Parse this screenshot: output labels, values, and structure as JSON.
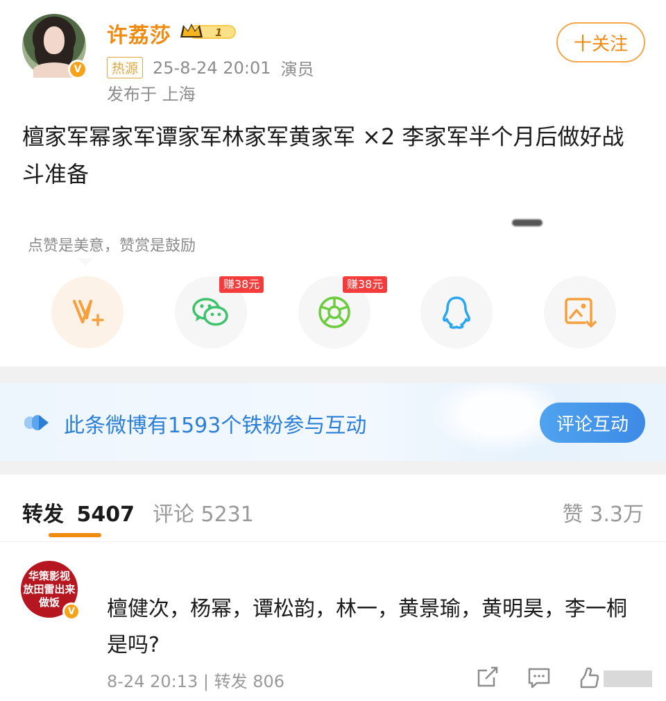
{
  "post": {
    "username": "许荔莎",
    "level_badge": "1",
    "hot_tag": "热源",
    "timestamp": "25-8-24 20:01",
    "role": "演员",
    "location": "发布于 上海",
    "follow_label": "十关注",
    "text": "檀家军幂家军谭家军林家军黄家军 ×2 李家军半个月后做好战斗准备"
  },
  "reward": {
    "tip": "点赞是美意，赞赏是鼓励"
  },
  "share": {
    "wechat_earn": "赚38元",
    "moments_earn": "赚38元"
  },
  "banner": {
    "text": "此条微博有1593个铁粉参与互动",
    "button": "评论互动"
  },
  "tabs": {
    "repost_label": "转发",
    "repost_count": "5407",
    "comment": "评论 5231",
    "like": "赞 3.3万"
  },
  "comment": {
    "avatar_text": [
      "华策影视",
      "放田雷出来",
      "做饭"
    ],
    "text": "檀健次，杨幂，谭松韵，林一，黄景瑜，黄明昊，李一桐是吗?",
    "meta": "8-24 20:13 | 转发 806"
  },
  "colors": {
    "accent": "#f08a11",
    "link_blue": "#2b7fd6",
    "earn_red": "#f43c3c"
  },
  "icons": [
    "vip-v-icon",
    "crown-badge-icon",
    "wechat-icon",
    "moments-icon",
    "qq-icon",
    "save-image-icon",
    "fans-interaction-icon",
    "repost-icon",
    "comment-icon",
    "like-icon"
  ]
}
